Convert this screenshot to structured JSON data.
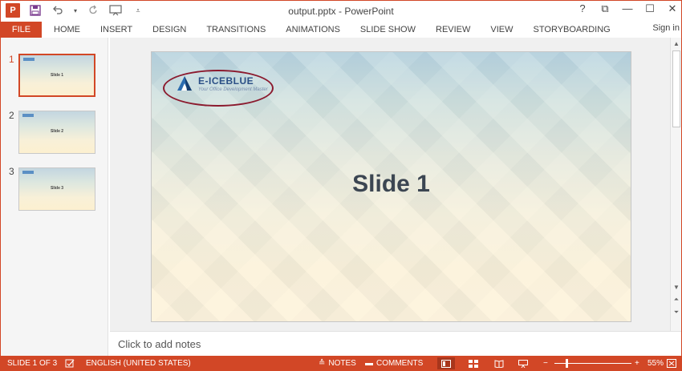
{
  "window": {
    "title": "output.pptx - PowerPoint",
    "app_icon_letter": "P",
    "controls": [
      "?",
      "⧉",
      "—",
      "☐",
      "✕"
    ]
  },
  "ribbon": {
    "file_label": "FILE",
    "tabs": [
      "HOME",
      "INSERT",
      "DESIGN",
      "TRANSITIONS",
      "ANIMATIONS",
      "SLIDE SHOW",
      "REVIEW",
      "VIEW",
      "STORYBOARDING"
    ],
    "signin": "Sign in"
  },
  "thumbnails": [
    {
      "number": "1",
      "title": "Slide 1",
      "selected": true
    },
    {
      "number": "2",
      "title": "Slide 2",
      "selected": false
    },
    {
      "number": "3",
      "title": "Slide 3",
      "selected": false
    }
  ],
  "slide": {
    "title": "Slide 1",
    "logo_name": "E-ICEBLUE",
    "logo_tagline": "Your Office Development Master",
    "accent_colors": {
      "oval": "#8b1a2e",
      "logo": "#2b4f86"
    }
  },
  "notes": {
    "placeholder": "Click to add notes"
  },
  "statusbar": {
    "slide_counter": "SLIDE 1 OF 3",
    "language": "ENGLISH (UNITED STATES)",
    "notes_label": "NOTES",
    "comments_label": "COMMENTS",
    "zoom_minus": "−",
    "zoom_plus": "+",
    "zoom_level": "55%",
    "zoom_fraction": 0.55
  },
  "theme": {
    "accent": "#d24726"
  }
}
